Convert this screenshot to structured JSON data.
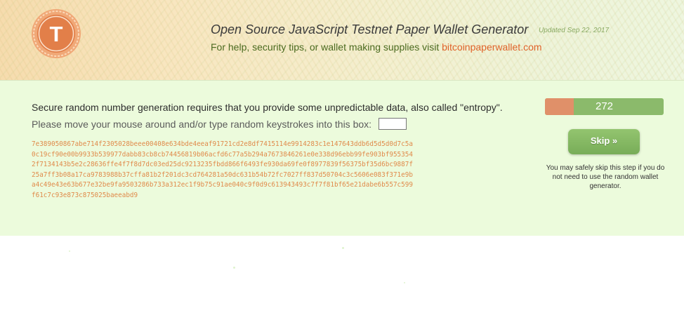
{
  "header": {
    "logo_letter": "T",
    "logo_icon": "testnet-coin-seal-icon",
    "title": "Open Source JavaScript Testnet Paper Wallet Generator",
    "updated": "Updated Sep 22, 2017",
    "help_prefix": "For help, security tips, or wallet making supplies visit ",
    "help_link": "bitcoinpaperwallet.com"
  },
  "entropy_panel": {
    "instruction_1": "Secure random number generation requires that you provide some unpredictable data, also called \"entropy\".",
    "instruction_2": "Please move your mouse around and/or type random keystrokes into this box:",
    "keystroke_input_value": "",
    "entropy_lines": [
      "7e389050867abe714f2305028beee00408e634bde4eeaf91721cd2e8df7415114e9914283c1e147643ddb6d5d5d0d7c5a",
      "0c19cf90e00b9933b539977dabb83cb8cb74456819b06acfd6c77a5b294a7673846261e0e338d96ebb99fe903bf955354",
      "2f7134143b5e2c28636ffe4f7f8d7dc03ed25dc9213235fbdd866f6493fe930da69fe0f8977839f56375bf35d6bc9887f",
      "25a7ff3b08a17ca9783988b37cffa81b2f201dc3cd764281a50dc631b54b72fc7027ff837d50704c3c5606e083f371e9b",
      "a4c49e43e63b677e32be9fa9503286b733a312ec1f9b75c91ae040c9f0d9c613943493c7f7f81bf65e21dabe6b557c599",
      "f61c7c93e873c875025baeeabd9"
    ]
  },
  "progress": {
    "value_text": "272",
    "fraction": 0.24
  },
  "skip": {
    "label": "Skip »",
    "note": "You may safely skip this step if you do not need to use the random wallet generator."
  },
  "colors": {
    "accent_orange": "#e0632a",
    "panel_green": "#ecfbdc",
    "progress_green": "#8bba6b",
    "progress_orange": "#e09069",
    "entropy_text": "#e08a4a"
  }
}
